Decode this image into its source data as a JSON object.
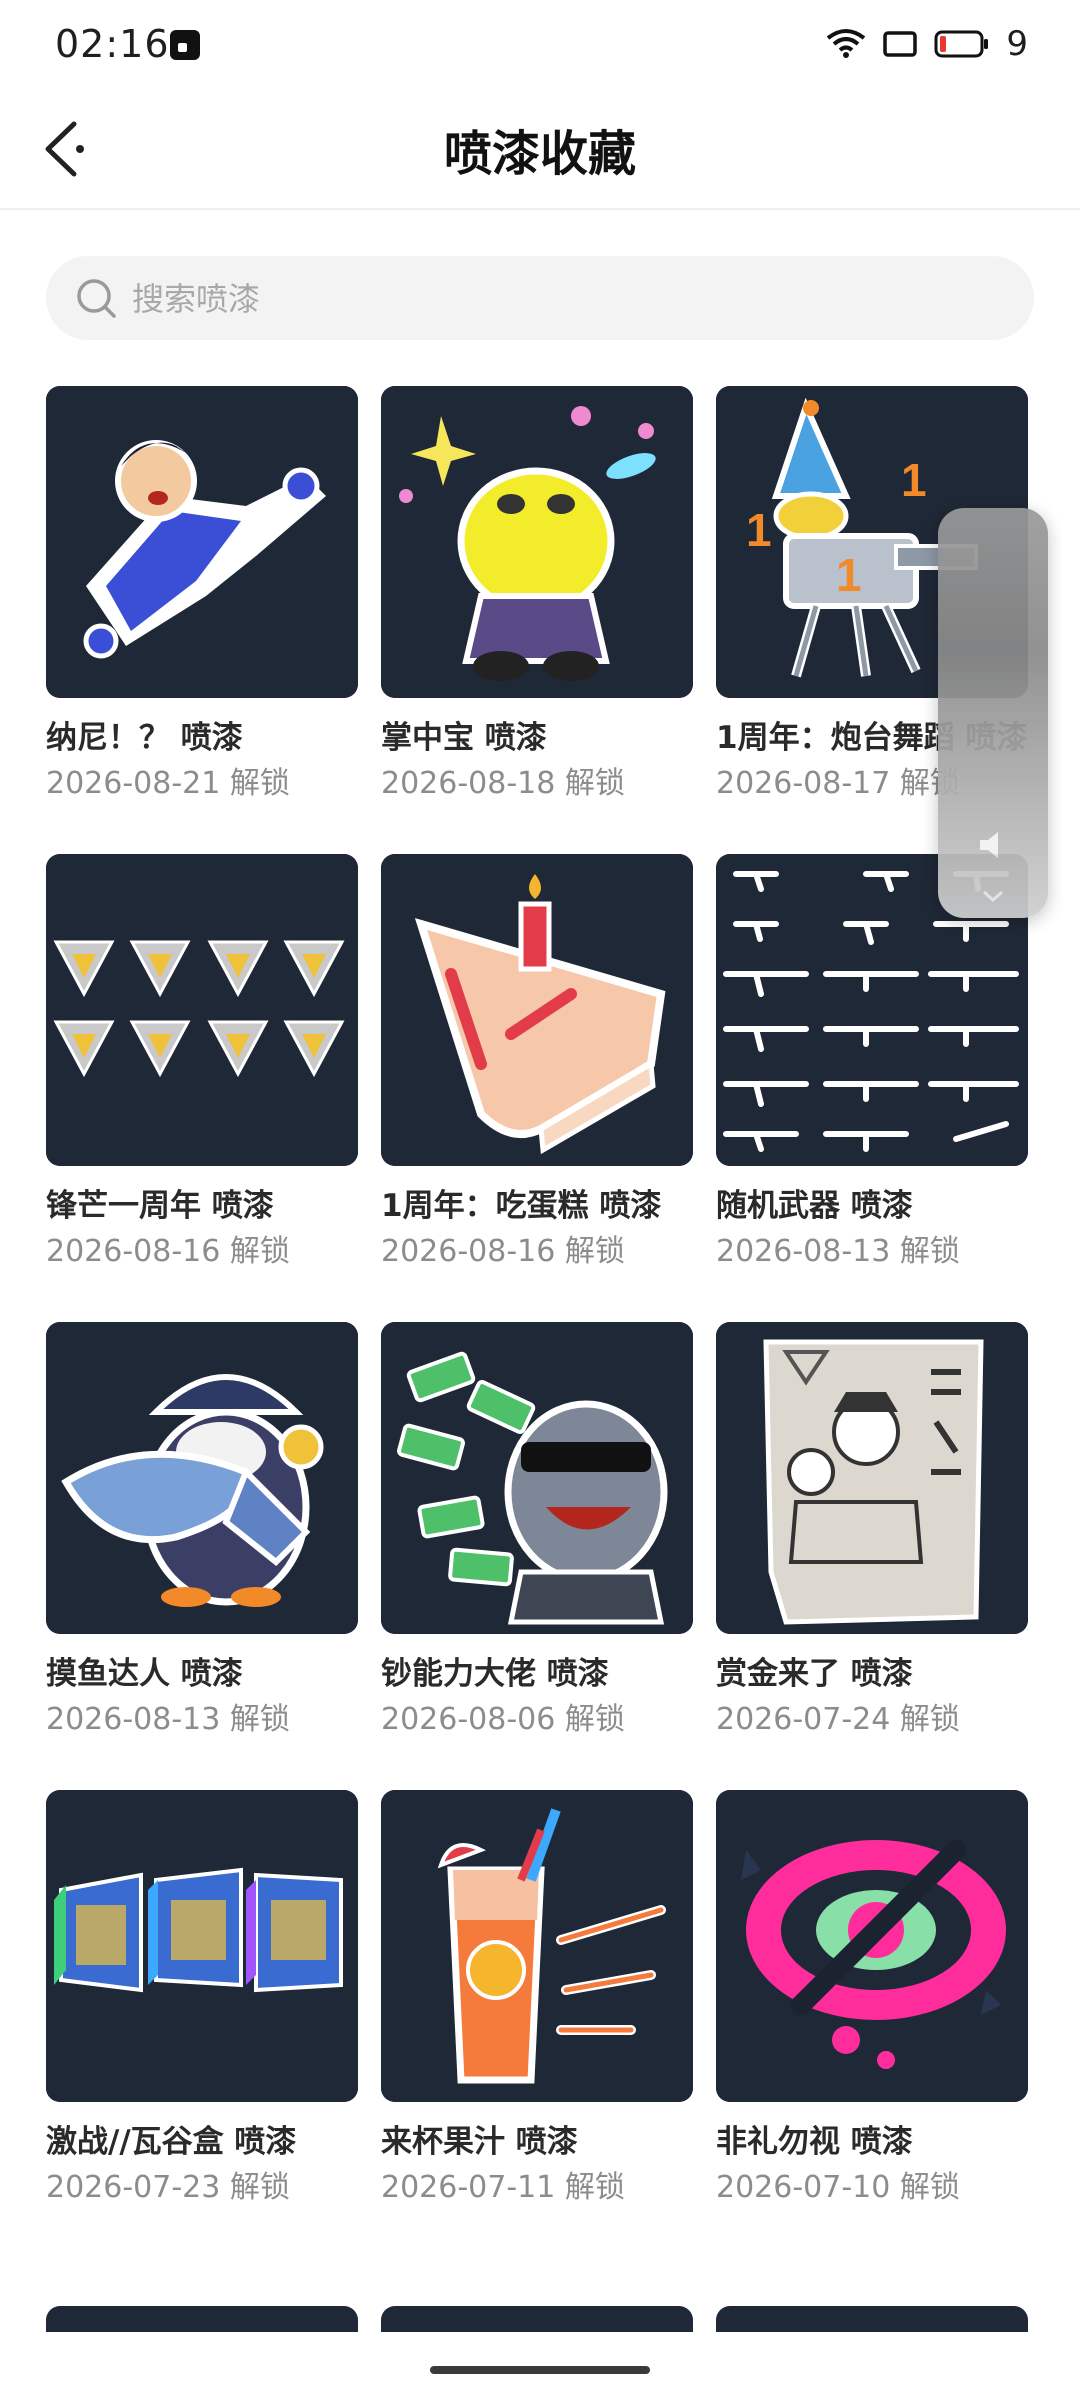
{
  "status_bar": {
    "time": "02:16",
    "battery": "9"
  },
  "header": {
    "title": "喷漆收藏"
  },
  "search": {
    "placeholder": "搜索喷漆"
  },
  "sprays": [
    {
      "title": "纳尼！？ 喷漆",
      "date": "2026-08-21 解锁"
    },
    {
      "title": "掌中宝 喷漆",
      "date": "2026-08-18 解锁"
    },
    {
      "title": "1周年：炮台舞蹈 喷漆",
      "date": "2026-08-17 解锁"
    },
    {
      "title": "锋芒一周年 喷漆",
      "date": "2026-08-16 解锁"
    },
    {
      "title": "1周年：吃蛋糕 喷漆",
      "date": "2026-08-16 解锁"
    },
    {
      "title": "随机武器 喷漆",
      "date": "2026-08-13 解锁"
    },
    {
      "title": "摸鱼达人 喷漆",
      "date": "2026-08-13 解锁"
    },
    {
      "title": "钞能力大佬 喷漆",
      "date": "2026-08-06 解锁"
    },
    {
      "title": "赏金来了 喷漆",
      "date": "2026-07-24 解锁"
    },
    {
      "title": "激战//瓦谷盒 喷漆",
      "date": "2026-07-23 解锁"
    },
    {
      "title": "来杯果汁 喷漆",
      "date": "2026-07-11 解锁"
    },
    {
      "title": "非礼勿视 喷漆",
      "date": "2026-07-10 解锁"
    }
  ],
  "colors": {
    "thumb_bg": "#1f2836",
    "accent_pink": "#ff2d9b"
  }
}
